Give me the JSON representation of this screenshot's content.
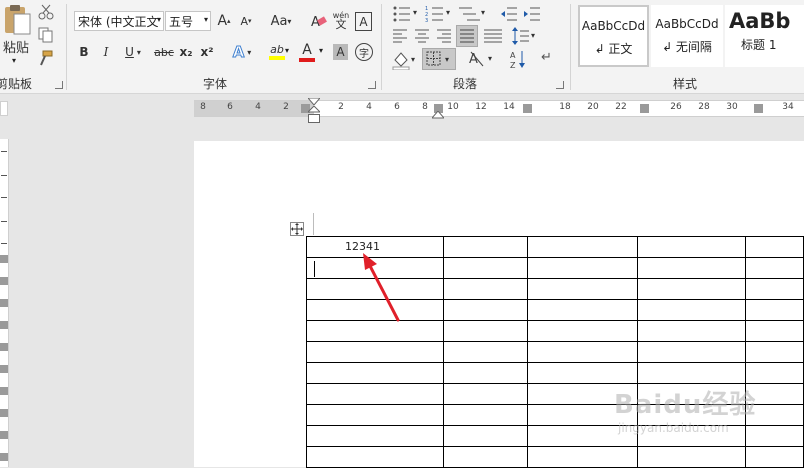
{
  "clipboard": {
    "paste_label": "粘贴",
    "group_label": "剪贴板"
  },
  "font": {
    "font_name": "宋体 (中文正文",
    "font_size": "五号",
    "group_label": "字体",
    "grow_label": "A",
    "shrink_label": "A",
    "case_label": "Aa",
    "phonetic_label": "wén",
    "border_char_label": "A",
    "bold_label": "B",
    "italic_label": "I",
    "underline_label": "U",
    "strike_label": "abc",
    "subscript_label": "x₂",
    "superscript_label": "x²",
    "effect_label": "A",
    "highlight_label": "ab",
    "color_label": "A",
    "shading_label": "A",
    "enclose_label": "字"
  },
  "paragraph": {
    "group_label": "段落"
  },
  "styles": {
    "group_label": "样式",
    "items": [
      {
        "sample": "AaBbCcDd",
        "name": "↲ 正文"
      },
      {
        "sample": "AaBbCcDd",
        "name": "↲ 无间隔"
      },
      {
        "sample": "AaBb",
        "name": "标题 1"
      }
    ]
  },
  "ruler": {
    "left_numbers": [
      "8",
      "6",
      "4",
      "2"
    ],
    "right_numbers": [
      "2",
      "4",
      "6",
      "8",
      "10",
      "12",
      "14",
      "18",
      "20",
      "22",
      "26",
      "28",
      "30",
      "34"
    ]
  },
  "document": {
    "table_cell_text": "12341",
    "table_rows": 11
  },
  "watermark": {
    "brand": "Baidu经验",
    "url": "jingyan.baidu.com"
  },
  "colors": {
    "annotation_arrow": "#e0202a",
    "highlight_yellow": "#ffff00",
    "font_red": "#e01b1b"
  }
}
